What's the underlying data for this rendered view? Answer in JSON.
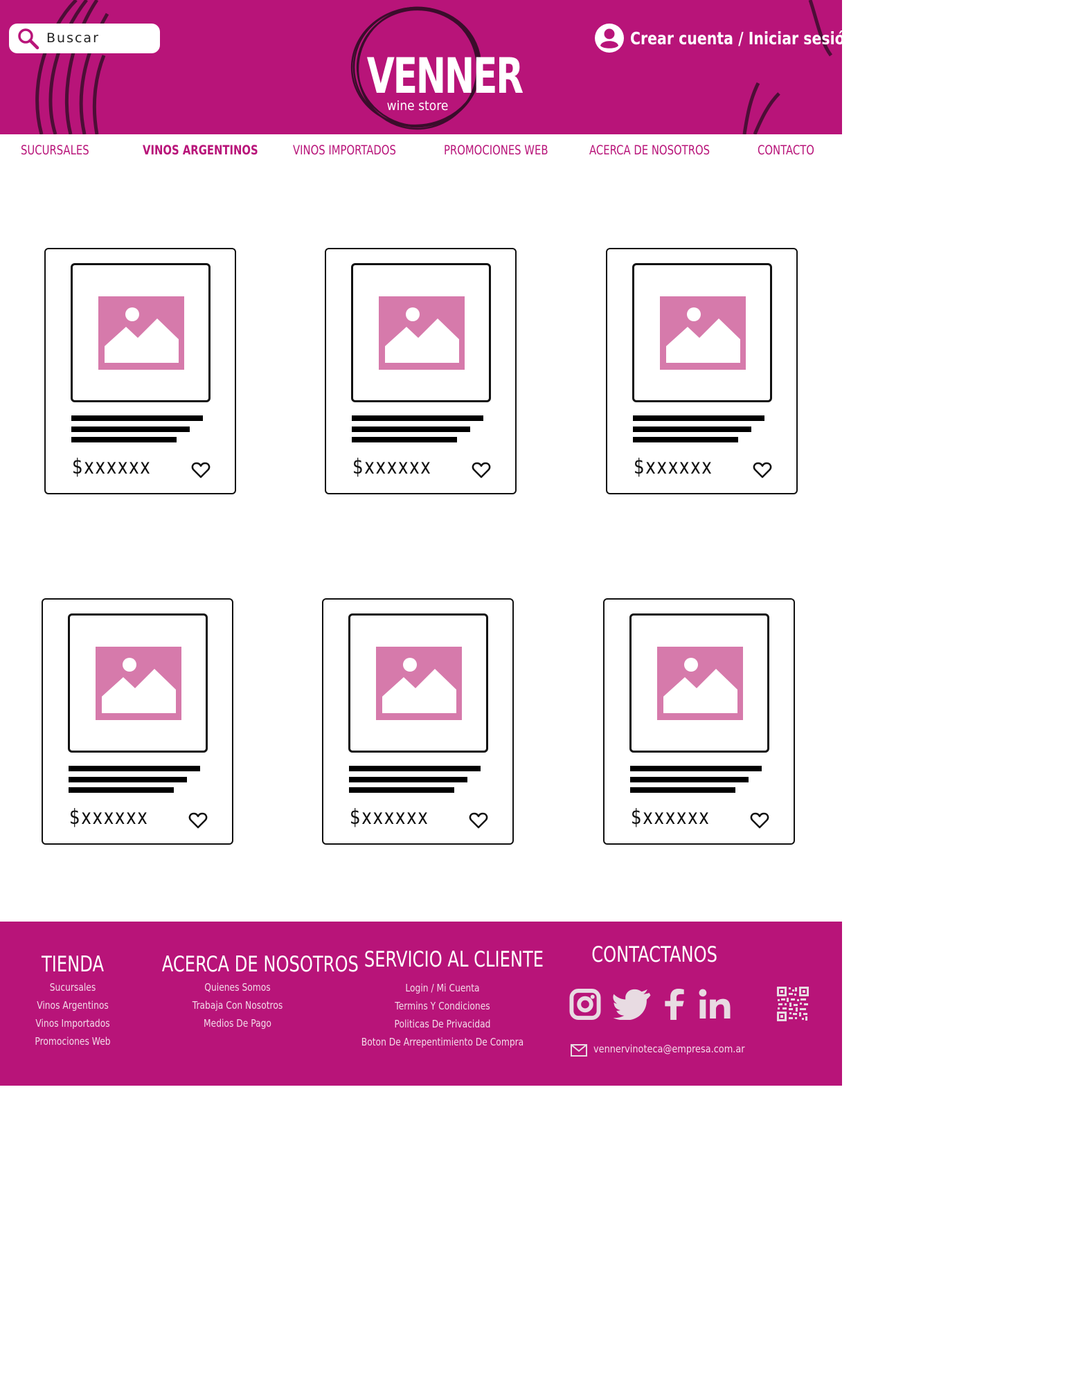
{
  "header": {
    "search": {
      "placeholder": "Buscar"
    },
    "logo": {
      "name": "VENNER",
      "tagline": "wine store"
    },
    "account_label": "Crear cuenta / Iniciar sesión"
  },
  "nav": {
    "items": [
      {
        "label": "SUCURSALES",
        "active": false
      },
      {
        "label": "VINOS ARGENTINOS",
        "active": true
      },
      {
        "label": "VINOS IMPORTADOS",
        "active": false
      },
      {
        "label": "PROMOCIONES WEB",
        "active": false
      },
      {
        "label": "ACERCA DE NOSOTROS",
        "active": false
      },
      {
        "label": "CONTACTO",
        "active": false
      }
    ]
  },
  "products": [
    {
      "price": "$xxxxxx",
      "image_icon": "image-placeholder-icon",
      "favorite_icon": "heart-icon"
    },
    {
      "price": "$xxxxxx",
      "image_icon": "image-placeholder-icon",
      "favorite_icon": "heart-icon"
    },
    {
      "price": "$xxxxxx",
      "image_icon": "image-placeholder-icon",
      "favorite_icon": "heart-icon"
    },
    {
      "price": "$xxxxxx",
      "image_icon": "image-placeholder-icon",
      "favorite_icon": "heart-icon"
    },
    {
      "price": "$xxxxxx",
      "image_icon": "image-placeholder-icon",
      "favorite_icon": "heart-icon"
    },
    {
      "price": "$xxxxxx",
      "image_icon": "image-placeholder-icon",
      "favorite_icon": "heart-icon"
    }
  ],
  "footer": {
    "tienda": {
      "title": "TIENDA",
      "links": [
        "Sucursales",
        "Vinos Argentinos",
        "Vinos Importados",
        "Promociones Web"
      ]
    },
    "acerca": {
      "title": "ACERCA DE  NOSOTROS",
      "links": [
        "Quienes Somos",
        "Trabaja Con Nosotros",
        "Medios De Pago"
      ]
    },
    "servicio": {
      "title": "SERVICIO AL CLIENTE",
      "links": [
        "Login / Mi Cuenta",
        "Termins Y Condiciones",
        "Politicas De Privacidad",
        "Boton De Arrepentimiento De Compra"
      ]
    },
    "contacto": {
      "title": "CONTACTANOS",
      "social": [
        "instagram-icon",
        "twitter-icon",
        "facebook-icon",
        "linkedin-icon"
      ],
      "email": "vennervinoteca@empresa.com.ar"
    }
  },
  "colors": {
    "brand": "#b81479",
    "image_placeholder": "#d67aab",
    "white": "#ffffff",
    "ink": "#111111"
  }
}
